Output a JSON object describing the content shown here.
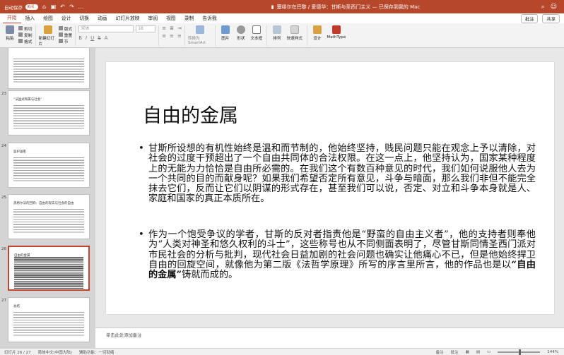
{
  "titlebar": {
    "autosave_label": "自动保存",
    "autosave_state": "关闭",
    "document_title": "塞缪尔在巴黎 / 爱德华：甘斯与圣西门主义 — 已保存到我的 Mac",
    "accent_color": "#b7472a"
  },
  "menu": {
    "tabs": [
      "开始",
      "插入",
      "绘图",
      "设计",
      "切换",
      "动画",
      "幻灯片放映",
      "审阅",
      "视图",
      "录制",
      "告诉我"
    ],
    "active_index": 0,
    "comments_label": "批注",
    "share_label": "共享"
  },
  "ribbon": {
    "paste_label": "粘贴",
    "cut_label": "剪切",
    "copy_label": "复制",
    "format_label": "格式",
    "new_slide_label": "新建幻灯片",
    "layout_label": "版式",
    "reset_label": "重置",
    "section_label": "节",
    "font_placeholder": "宋体",
    "size_placeholder": "18",
    "convert_label": "转换为 SmartArt",
    "picture_label": "图片",
    "shape_label": "形状",
    "textbox_label": "文本框",
    "arrange_label": "排列",
    "quick_styles_label": "快速样式",
    "design_label": "设计",
    "mathtype_label": "MathType"
  },
  "thumbnails": [
    {
      "number": "",
      "title": "",
      "dense": false,
      "active": false
    },
    {
      "number": "23",
      "title": "“法国式和属与社会”",
      "dense": false,
      "active": false
    },
    {
      "number": "24",
      "title": "监护国家",
      "dense": false,
      "active": false
    },
    {
      "number": "25",
      "title": "黑格尔法的回响：自由的现实与社会的自由",
      "dense": false,
      "active": false
    },
    {
      "number": "26",
      "title": "自由的金属",
      "dense": true,
      "active": true
    },
    {
      "number": "27",
      "title": "总结",
      "dense": false,
      "active": false
    }
  ],
  "slide": {
    "title": "自由的金属",
    "bullet1": "甘斯所设想的有机性始终是温和而节制的，他始终坚持，贱民问题只能在观念上予以清除，对社会的过度干预超出了一个自由共同体的合法权限。在这一点上，他坚持认为，国家某种程度上的无能为力恰恰是自由所必需的。在我们这个有数百种意见的时代，我们如何说服他人去为一个共同的目的而献身呢？如果我们希望否定所有意见，斗争与暗面，那么我们非但不能完全抹去它们，反而让它们以阴谋的形式存在，甚至我们可以说，否定、对立和斗争本身就是人、家庭和国家的真正本质所在。",
    "bullet2_part1": "作为一个饱受争议的学者，甘斯的反对者指责他是“野蛮的自由主义者”，他的支持者则奉他为“人类对神圣和悠久权利的斗士”，这些称号也从不同侧面表明了，尽管甘斯同情圣西门派对市民社会的分析与批判，现代社会日益加剧的社会问题也确实让他痛心不已，但是他始终捍卫自由的回旋空间，就像他为第二版《法哲学原理》所写的序言里所言，他的作品也是以",
    "bullet2_bold": "“自由的金属”",
    "bullet2_part2": "铸就而成的。"
  },
  "notes": {
    "placeholder": "单击此处添加备注"
  },
  "status": {
    "slide_counter": "幻灯片 26 / 27",
    "language": "简体中文(中国大陆)",
    "accessibility": "辅助功能：一切就绪",
    "notes_label": "备注",
    "comments_label": "批注",
    "zoom": "144%"
  }
}
